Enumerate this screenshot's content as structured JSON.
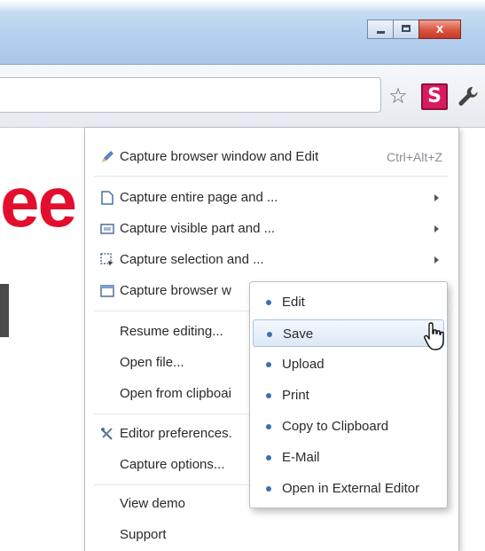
{
  "window": {
    "controls": {
      "minimize": "minimize",
      "maximize": "maximize",
      "close": "x"
    }
  },
  "toolbar": {
    "icons": [
      "star-icon",
      "screencapture-s-icon",
      "wrench-icon"
    ],
    "extension_letter": "S"
  },
  "page": {
    "partial_text": "ee",
    "accent_color": "#e30e2e"
  },
  "menu": {
    "capture_window_edit": {
      "label": "Capture browser window and Edit",
      "shortcut": "Ctrl+Alt+Z"
    },
    "capture_entire": {
      "label": "Capture entire page and ..."
    },
    "capture_visible": {
      "label": "Capture visible part and ..."
    },
    "capture_selection": {
      "label": "Capture selection and ..."
    },
    "capture_browser": {
      "label": "Capture browser w"
    },
    "resume_editing": {
      "label": "Resume editing..."
    },
    "open_file": {
      "label": "Open file..."
    },
    "open_clipboard": {
      "label": "Open from clipboai"
    },
    "editor_prefs": {
      "label": "Editor preferences."
    },
    "capture_options": {
      "label": "Capture options..."
    },
    "view_demo": {
      "label": "View demo"
    },
    "support": {
      "label": "Support"
    }
  },
  "submenu": {
    "items": [
      {
        "label": "Edit"
      },
      {
        "label": "Save"
      },
      {
        "label": "Upload"
      },
      {
        "label": "Print"
      },
      {
        "label": "Copy to Clipboard"
      },
      {
        "label": "E-Mail"
      },
      {
        "label": "Open in External Editor"
      }
    ],
    "hovered_index": 1
  },
  "colors": {
    "extension_brand": "#d81b60",
    "bullet": "#3b6fb3",
    "hover_bg": "#dce8f6"
  }
}
